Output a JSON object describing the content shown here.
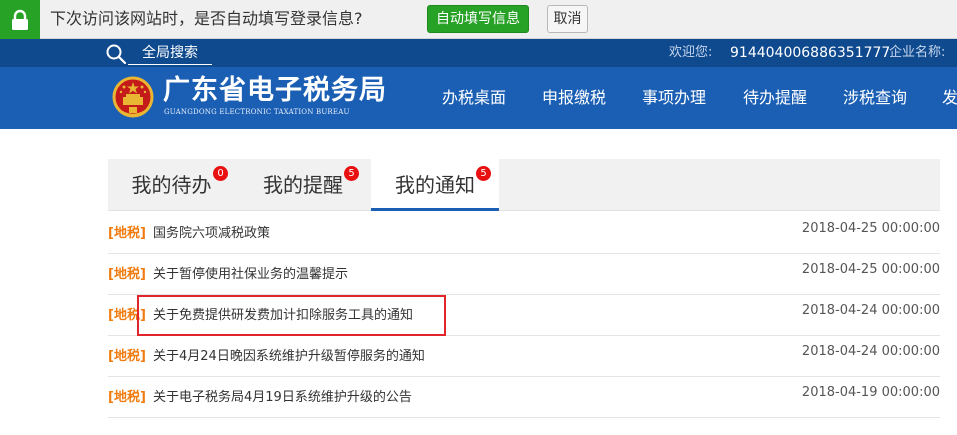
{
  "autofill_bar": {
    "prompt": "下次访问该网站时，是否自动填写登录信息?",
    "fill_button": "自动填写信息",
    "cancel_button": "取消"
  },
  "top_bar": {
    "search_label": "全局搜索",
    "welcome_label": "欢迎您:",
    "taxpayer_id": "914404006886351777",
    "company_label": "企业名称:"
  },
  "header": {
    "title": "广东省电子税务局",
    "subtitle": "GUANGDONG ELECTRONIC TAXATION BUREAU",
    "brand_color": "#1b5fb4",
    "nav": [
      "办税桌面",
      "申报缴税",
      "事项办理",
      "待办提醒",
      "涉税查询",
      "发"
    ]
  },
  "tabs": [
    {
      "label": "我的待办",
      "badge": "0"
    },
    {
      "label": "我的提醒",
      "badge": "5"
    },
    {
      "label": "我的通知",
      "badge": "5",
      "active": true
    }
  ],
  "notices": [
    {
      "tag": "[地税]",
      "title": "国务院六项减税政策",
      "date": "2018-04-25 00:00:00"
    },
    {
      "tag": "[地税]",
      "title": "关于暂停使用社保业务的温馨提示",
      "date": "2018-04-25 00:00:00"
    },
    {
      "tag": "[地税]",
      "title": "关于免费提供研发费加计扣除服务工具的通知",
      "date": "2018-04-24 00:00:00",
      "highlighted": true
    },
    {
      "tag": "[地税]",
      "title": "关于4月24日晚因系统维护升级暂停服务的通知",
      "date": "2018-04-24 00:00:00"
    },
    {
      "tag": "[地税]",
      "title": "关于电子税务局4月19日系统维护升级的公告",
      "date": "2018-04-19 00:00:00"
    }
  ]
}
